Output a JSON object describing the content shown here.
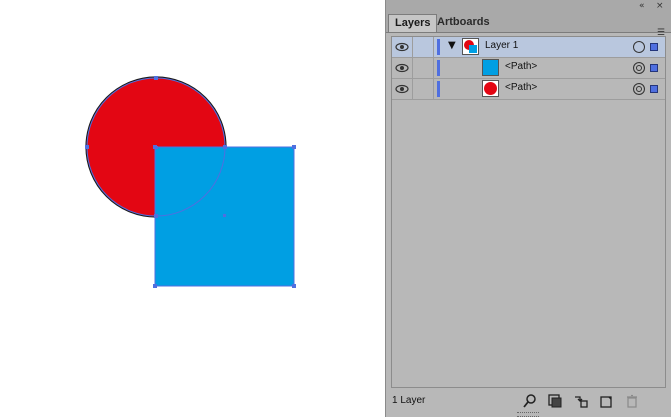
{
  "colors": {
    "circle_fill": "#e30613",
    "square_fill": "#009fe3",
    "selection": "#4f6fe0",
    "panel_bg": "#b8b8b8",
    "selected_row": "#b9c7de"
  },
  "panel": {
    "tabs": [
      {
        "label": "Layers",
        "active": true
      },
      {
        "label": "Artboards",
        "active": false
      }
    ],
    "layers": [
      {
        "label": "Layer 1",
        "type": "layer",
        "expanded": true,
        "selected": true
      },
      {
        "label": "<Path>",
        "type": "path",
        "thumb": "blue-square"
      },
      {
        "label": "<Path>",
        "type": "path",
        "thumb": "red-circle"
      }
    ],
    "footer": {
      "count_text": "1 Layer"
    }
  },
  "icons": {
    "visibility": "eye-icon",
    "expand": "triangle-down-icon",
    "target": "target-circle-icon",
    "collapse": "double-chevron-left-icon",
    "close": "close-icon",
    "menu": "panel-menu-icon",
    "locate": "search-icon",
    "clip_mask": "clip-mask-icon",
    "new_sublayer": "new-sublayer-icon",
    "new_layer": "new-layer-icon",
    "delete": "trash-icon"
  }
}
